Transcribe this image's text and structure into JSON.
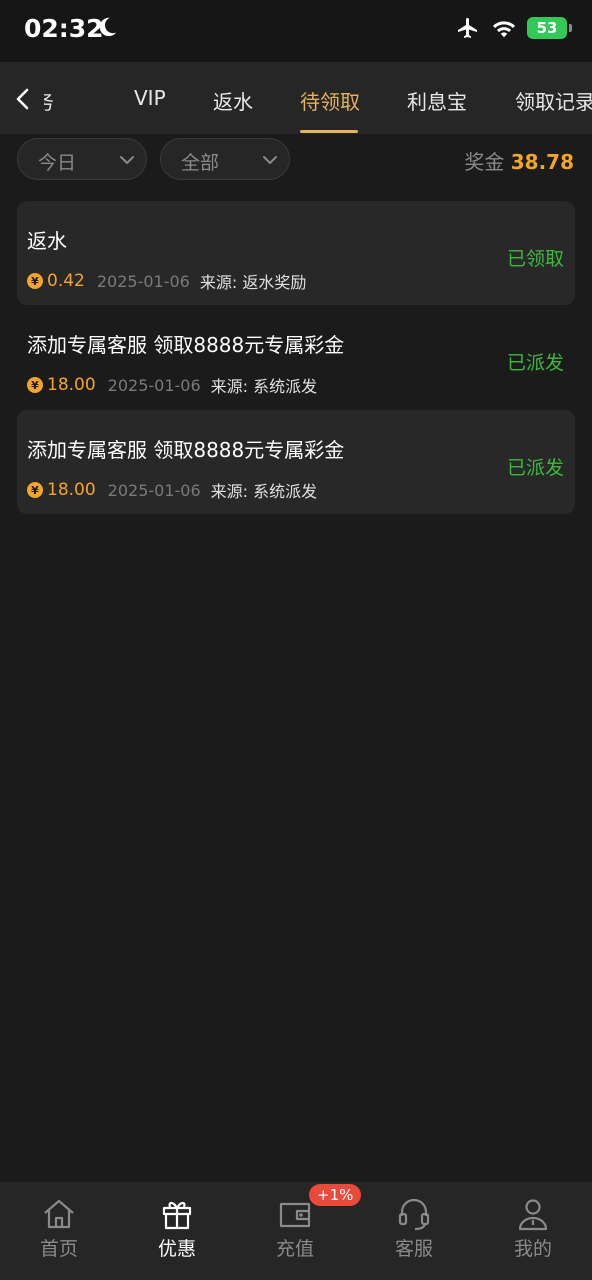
{
  "status_bar": {
    "time": "02:32",
    "battery": "53"
  },
  "tabs": [
    {
      "label": "任务"
    },
    {
      "label": "VIP"
    },
    {
      "label": "返水"
    },
    {
      "label": "待领取"
    },
    {
      "label": "利息宝"
    },
    {
      "label": "领取记录"
    }
  ],
  "filters": {
    "date": "今日",
    "category": "全部"
  },
  "bonus": {
    "label": "奖金",
    "value": "38.78"
  },
  "records": [
    {
      "title": "返水",
      "amount": "0.42",
      "date": "2025-01-06",
      "source": "来源: 返水奖励",
      "status": "已领取"
    },
    {
      "title": "添加专属客服 领取8888元专属彩金",
      "amount": "18.00",
      "date": "2025-01-06",
      "source": "来源: 系统派发",
      "status": "已派发"
    },
    {
      "title": "添加专属客服 领取8888元专属彩金",
      "amount": "18.00",
      "date": "2025-01-06",
      "source": "来源: 系统派发",
      "status": "已派发"
    }
  ],
  "coin_symbol": "¥",
  "bottom_nav": [
    {
      "label": "首页",
      "icon": "home-icon"
    },
    {
      "label": "优惠",
      "icon": "gift-icon"
    },
    {
      "label": "充值",
      "icon": "wallet-icon"
    },
    {
      "label": "客服",
      "icon": "headset-icon"
    },
    {
      "label": "我的",
      "icon": "user-icon"
    }
  ],
  "recharge_badge": "+1%",
  "colors": {
    "accent": "#e6b25a",
    "amount": "#f3a42b",
    "success": "#3db83d",
    "badge": "#e84a3c"
  }
}
